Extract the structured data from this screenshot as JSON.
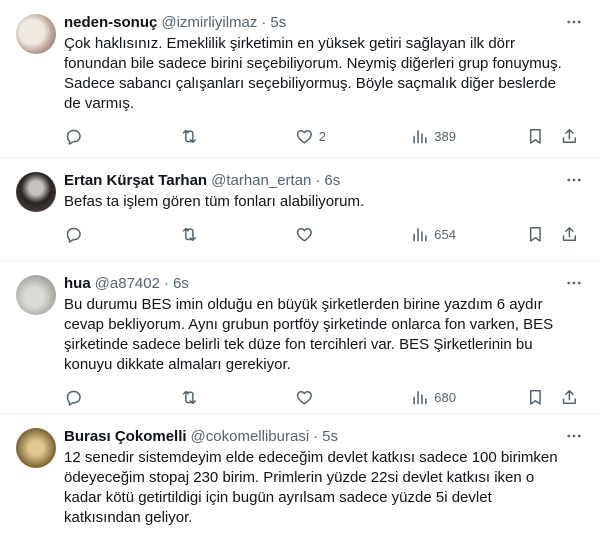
{
  "tweets": [
    {
      "name": "neden-sonuç",
      "handle": "@izmirliyilmaz",
      "sep": "·",
      "time": "5s",
      "text": "Çok haklısınız. Emeklilik şirketimin en yüksek getiri sağlayan ilk dörr\nfonundan bile sadece birini seçebiliyorum. Neymiş diğerleri grup fonuymuş.\nSadece sabancı çalışanları seçebiliyormuş. Böyle saçmalık diğer beslerde\nde varmış.",
      "replies": "",
      "retweets": "",
      "likes": "2",
      "views": "389"
    },
    {
      "name": "Ertan Kürşat Tarhan",
      "handle": "@tarhan_ertan",
      "sep": "·",
      "time": "6s",
      "text": "Befas ta işlem gören tüm fonları alabiliyorum.",
      "replies": "",
      "retweets": "",
      "likes": "",
      "views": "654"
    },
    {
      "name": "hua",
      "handle": "@a87402",
      "sep": "·",
      "time": "6s",
      "text": "Bu durumu BES imin olduğu en büyük şirketlerden birine yazdım 6 aydır\ncevap bekliyorum. Aynı grubun portföy şirketinde onlarca fon varken, BES\nşirketinde sadece belirli tek düze fon tercihleri var. BES Şirketlerinin bu\nkonuyu dikkate almaları gerekiyor.",
      "replies": "",
      "retweets": "",
      "likes": "",
      "views": "680"
    },
    {
      "name": "Burası Çokomelli",
      "handle": "@cokomelliburasi",
      "sep": "·",
      "time": "5s",
      "text": "12 senedir sistemdeyim elde edeceğim devlet katkısı sadece 100 birimken\nödeyeceğim stopaj 230 birim. Primlerin yüzde 22si devlet katkısı iken o\nkadar kötü getirtildigi için bugün ayrılsam sadece yüzde 5i devlet\nkatkısından geliyor."
    }
  ]
}
